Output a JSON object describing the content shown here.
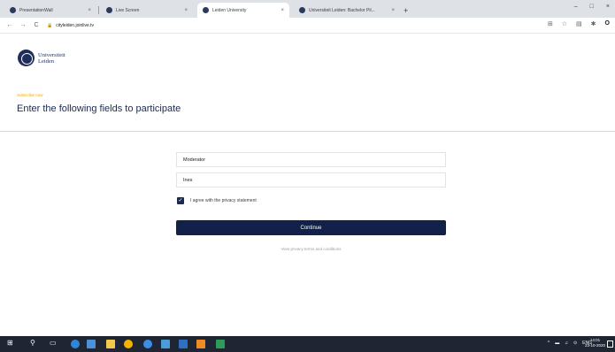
{
  "browser": {
    "tabs": [
      {
        "label": "PresentationWall",
        "close": "×",
        "active": false
      },
      {
        "label": "Live Screen",
        "close": "×",
        "active": false
      },
      {
        "label": "Leiden University",
        "close": "×",
        "active": true
      },
      {
        "label": "Universiteit Leiden: Bachelor Pil...",
        "close": "×",
        "active": false
      }
    ],
    "new_tab": "+",
    "window_controls": {
      "minimize": "–",
      "maximize": "□",
      "close": "×"
    },
    "nav": {
      "back": "←",
      "forward": "→",
      "reload": "C"
    },
    "url": "cityleiden.joinlive.tv",
    "lock": "🔒",
    "toolbar_icons": [
      "translate-icon",
      "star-icon",
      "extension-icon",
      "puzzle-icon",
      "profile-icon"
    ],
    "profile_initial": "O"
  },
  "page": {
    "logo": {
      "line1": "Universiteit",
      "line2": "Leiden"
    },
    "eyebrow": "Subscribe now",
    "heading": "Enter the following fields to participate",
    "fields": {
      "role_value": "Moderator",
      "name_value": "Ines"
    },
    "consent": {
      "checked": true,
      "check_glyph": "✓",
      "label": "I agree with the privacy statement"
    },
    "continue_label": "Continue",
    "terms_link": "View privacy terms and conditions"
  },
  "taskbar": {
    "tray_glyphs": [
      "^",
      "▬",
      "♫",
      "⊙",
      "ENG"
    ],
    "time": "14:01",
    "date": "23-10-2020"
  },
  "colors": {
    "navy": "#13214a",
    "accent": "#f0a800",
    "taskbar": "#1f2532"
  }
}
